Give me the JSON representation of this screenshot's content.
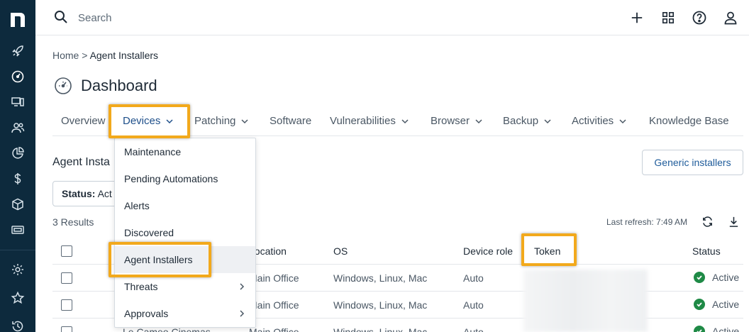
{
  "app": {
    "accent": "#f2a91c",
    "rail_bg": "#0d2a3d"
  },
  "rail": {
    "icons": [
      "rocket-icon",
      "dashboard-gauge-icon",
      "devices-icon",
      "users-icon",
      "reports-pie-icon",
      "billing-dollar-icon",
      "software-box-icon",
      "ticket-icon",
      "settings-gear-icon",
      "favorites-star-icon",
      "history-icon"
    ]
  },
  "topbar": {
    "search_placeholder": "Search"
  },
  "breadcrumb": {
    "home": "Home",
    "sep": ">",
    "current": "Agent Installers"
  },
  "page": {
    "title": "Dashboard"
  },
  "tabs": [
    {
      "label": "Overview"
    },
    {
      "label": "Devices"
    },
    {
      "label": "Patching"
    },
    {
      "label": "Software"
    },
    {
      "label": "Vulnerabilities"
    },
    {
      "label": "Browser"
    },
    {
      "label": "Backup"
    },
    {
      "label": "Activities"
    },
    {
      "label": "Knowledge Base"
    }
  ],
  "dropdown": {
    "items": [
      {
        "label": "Maintenance"
      },
      {
        "label": "Pending Automations"
      },
      {
        "label": "Alerts"
      },
      {
        "label": "Discovered"
      },
      {
        "label": "Agent Installers"
      },
      {
        "label": "Threats"
      },
      {
        "label": "Approvals"
      }
    ]
  },
  "section": {
    "title": "Agent Insta",
    "generic_button": "Generic installers",
    "filter_label": "Status:",
    "filter_value": "Act"
  },
  "results": "3 Results",
  "refresh": "Last refresh: 7:49 AM",
  "table": {
    "headers": {
      "location": "Location",
      "os": "OS",
      "role": "Device role",
      "token": "Token",
      "status": "Status"
    },
    "rows": [
      {
        "name": "",
        "location": "Main Office",
        "os": "Windows, Linux, Mac",
        "role": "Auto",
        "status": "Active"
      },
      {
        "name": "",
        "location": "Main Office",
        "os": "Windows, Linux, Mac",
        "role": "Auto",
        "status": "Active"
      },
      {
        "name": "Le Cameo Cinemas",
        "location": "Main Office",
        "os": "Windows, Linux, Mac",
        "role": "Auto",
        "status": "Active"
      }
    ]
  }
}
